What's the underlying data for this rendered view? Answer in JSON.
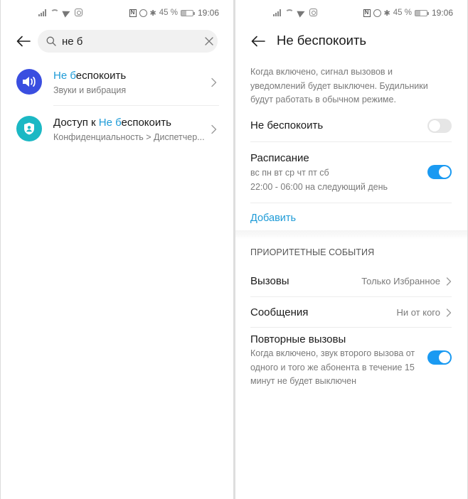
{
  "status_bar": {
    "battery_percent": "45 %",
    "time": "19:06",
    "icons_left": [
      "signal-icon",
      "wifi-icon",
      "telegram-icon",
      "instagram-icon"
    ],
    "icons_right": [
      "nfc-icon",
      "alarm-icon",
      "bluetooth-icon",
      "battery-icon"
    ]
  },
  "search_screen": {
    "search": {
      "value": "не б",
      "placeholder": ""
    },
    "results": [
      {
        "title_prefix": "",
        "title_highlight": "Не б",
        "title_rest": "еспокоить",
        "subtitle": "Звуки и вибрация",
        "icon": "speaker-icon",
        "icon_color": "#3a4ee0"
      },
      {
        "title_prefix": "Доступ к ",
        "title_highlight": "Не б",
        "title_rest": "еспокоить",
        "subtitle": "Конфиденциальность > Диспетчер...",
        "icon": "shield-user-icon",
        "icon_color": "#1bb8c4"
      }
    ]
  },
  "dnd_screen": {
    "title": "Не беспокоить",
    "description": "Когда включено, сигнал вызовов и уведомлений будет выключен. Будильники будут работать в обычном режиме.",
    "dnd_toggle": {
      "label": "Не беспокоить",
      "on": false
    },
    "schedule": {
      "label": "Расписание",
      "days": "вс пн вт ср чт пт сб",
      "time_range": "22:00 - 06:00 на следующий день",
      "on": true
    },
    "add_label": "Добавить",
    "priority_header": "ПРИОРИТЕТНЫЕ СОБЫТИЯ",
    "calls": {
      "label": "Вызовы",
      "value": "Только Избранное"
    },
    "messages": {
      "label": "Сообщения",
      "value": "Ни от кого"
    },
    "repeat_calls": {
      "label": "Повторные вызовы",
      "description": "Когда включено, звук второго вызова от одного и того же абонента в течение 15 минут не будет выключен",
      "on": true
    }
  },
  "colors": {
    "accent": "#1e9bd7",
    "toggle_on": "#1a9af2",
    "toggle_off": "#e6e6e6"
  }
}
